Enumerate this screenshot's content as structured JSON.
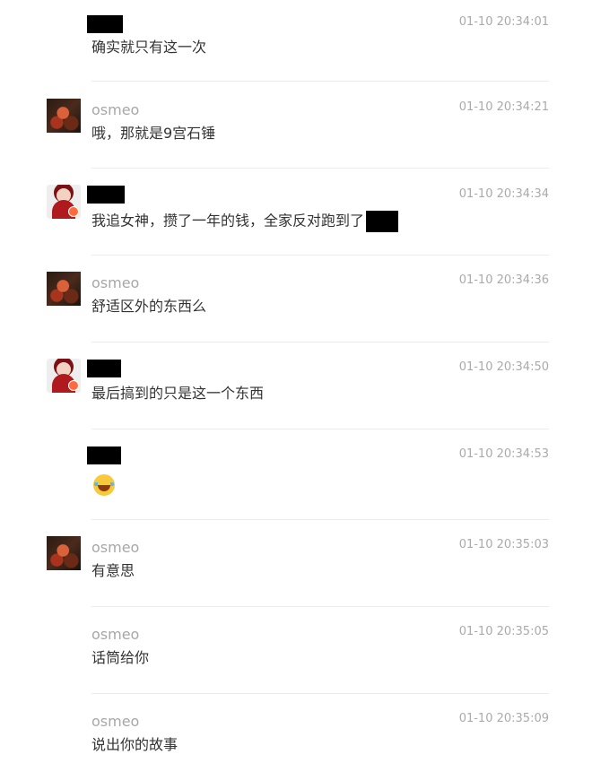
{
  "messages": [
    {
      "user": "",
      "time": "01-10 20:34:01",
      "text": "确实就只有这一次"
    },
    {
      "user": "osmeo",
      "time": "01-10 20:34:21",
      "text": "哦，那就是9宫石锤"
    },
    {
      "user": "",
      "time": "01-10 20:34:34",
      "text": "我追女神，攒了一年的钱，全家反对跑到了"
    },
    {
      "user": "osmeo",
      "time": "01-10 20:34:36",
      "text": "舒适区外的东西么"
    },
    {
      "user": "",
      "time": "01-10 20:34:50",
      "text": "最后搞到的只是这一个东西"
    },
    {
      "user": "",
      "time": "01-10 20:34:53",
      "text": "",
      "emoji": "laughing-tears-emoji"
    },
    {
      "user": "osmeo",
      "time": "01-10 20:35:03",
      "text": "有意思"
    },
    {
      "user": "osmeo",
      "time": "01-10 20:35:05",
      "text": "话筒给你"
    },
    {
      "user": "osmeo",
      "time": "01-10 20:35:09",
      "text": "说出你的故事"
    }
  ],
  "colors": {
    "name": "#a7a7a7",
    "time": "#aaaaaa",
    "text": "#333333",
    "divider": "#ececec"
  }
}
